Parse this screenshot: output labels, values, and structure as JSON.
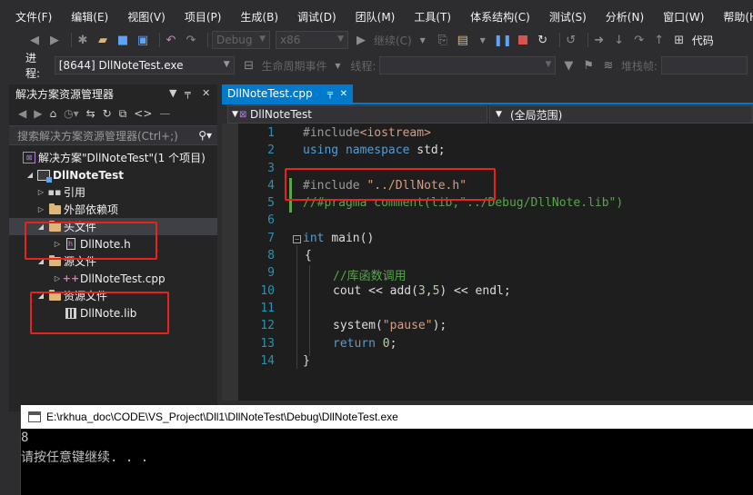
{
  "menu": [
    "文件(F)",
    "编辑(E)",
    "视图(V)",
    "项目(P)",
    "生成(B)",
    "调试(D)",
    "团队(M)",
    "工具(T)",
    "体系结构(C)",
    "测试(S)",
    "分析(N)",
    "窗口(W)",
    "帮助(H)"
  ],
  "toolbar": {
    "config": "Debug",
    "platform": "x86",
    "continue_label": "继续(C)",
    "right_label": "代码"
  },
  "debug_bar": {
    "process_label": "进程:",
    "process_value": "[8644] DllNoteTest.exe",
    "lifecycle_label": "生命周期事件",
    "thread_label": "线程:",
    "stack_label": "堆栈帧:"
  },
  "solution_explorer": {
    "title": "解决方案资源管理器",
    "search_placeholder": "搜索解决方案资源管理器(Ctrl+;)",
    "solution_label": "解决方案\"DllNoteTest\"(1 个项目)",
    "project_label": "DllNoteTest",
    "references_label": "引用",
    "external_deps_label": "外部依赖项",
    "header_folder_label": "头文件",
    "header_file_label": "DllNote.h",
    "source_folder_label": "源文件",
    "source_file_label": "DllNoteTest.cpp",
    "resource_folder_label": "资源文件",
    "resource_file_label": "DllNote.lib"
  },
  "editor": {
    "tab_label": "DllNoteTest.cpp",
    "nav_project": "DllNoteTest",
    "nav_scope": "(全局范围)",
    "line_numbers": [
      "1",
      "2",
      "3",
      "4",
      "5",
      "6",
      "7",
      "8",
      "9",
      "10",
      "11",
      "12",
      "13",
      "14"
    ],
    "code": {
      "l1_directive": "#include",
      "l1_header": "<iostream>",
      "l2_using": "using",
      "l2_namespace": "namespace",
      "l2_std": "std;",
      "l4_directive": "#include",
      "l4_header": "\"../DllNote.h\"",
      "l5_comment": "//#pragma comment(lib,\"../Debug/DllNote.lib\")",
      "l7_int": "int",
      "l7_main": "main()",
      "l8_open": "{",
      "l9_comment": "//库函数调用",
      "l10_a": "cout << add(",
      "l10_n1": "3",
      "l10_b": ",",
      "l10_n2": "5",
      "l10_c": ") << endl;",
      "l12_a": "system(",
      "l12_str": "\"pause\"",
      "l12_b": ");",
      "l13_return": "return",
      "l13_zero": "0",
      "l13_semi": ";",
      "l14_close": "}"
    }
  },
  "console": {
    "title": "E:\\rkhua_doc\\CODE\\VS_Project\\Dll1\\DllNoteTest\\Debug\\DllNoteTest.exe",
    "lines": [
      "8",
      "请按任意键继续. . ."
    ]
  },
  "colors": {
    "accent": "#007acc",
    "highlight_box": "#e8231e",
    "keyword": "#569cd6",
    "string": "#d69d85",
    "comment": "#57a64a"
  }
}
